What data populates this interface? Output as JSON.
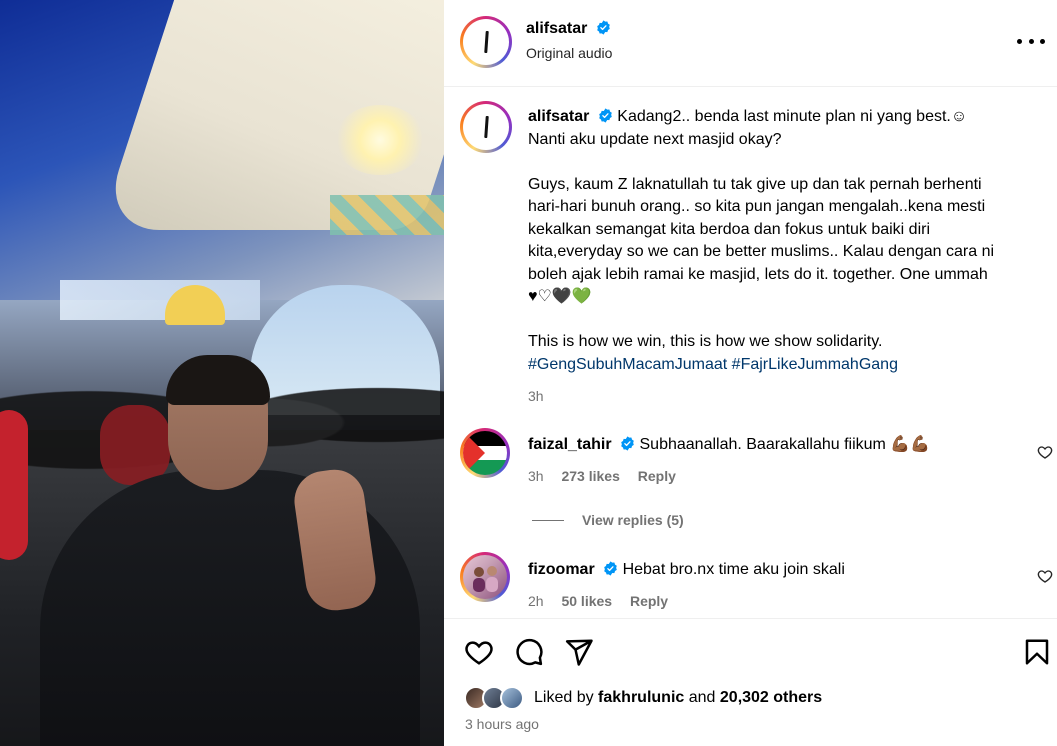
{
  "post": {
    "username": "alifsatar",
    "audio": "Original audio",
    "caption_lines": [
      "Kadang2.. benda last minute plan ni yang best.☺",
      "Nanti aku update next masjid okay?",
      "",
      "Guys, kaum Z laknatullah tu tak give up dan tak pernah berhenti",
      "hari-hari bunuh orang.. so kita pun jangan mengalah..kena mesti",
      "kekalkan semangat kita berdoa dan fokus untuk baiki diri",
      "kita,everyday so we can be better muslims.. Kalau dengan cara ni",
      "boleh ajak lebih ramai ke masjid, lets do it. together. One ummah",
      "♥♡🖤💚",
      "",
      "This is how we win, this is how we show solidarity."
    ],
    "hashtags": "#GengSubuhMacamJumaat #FajrLikeJummahGang",
    "caption_time": "3h"
  },
  "comments": [
    {
      "username": "faizal_tahir",
      "text": "Subhaanallah. Baarakallahu fiikum 💪🏾💪🏾",
      "time": "3h",
      "likes": "273 likes",
      "reply": "Reply",
      "view_replies": "View replies (5)"
    },
    {
      "username": "fizoomar",
      "text": "Hebat bro.nx time aku join skali",
      "time": "2h",
      "likes": "50 likes",
      "reply": "Reply"
    }
  ],
  "likes_summary": {
    "prefix": "Liked by",
    "user": "fakhrulunic",
    "connector": "and",
    "others": "20,302 others"
  },
  "timestamp": "3 hours ago",
  "colors": {
    "hashtag": "#00376b",
    "verified": "#0095f6",
    "muted": "#737373"
  },
  "icons": [
    "more-icon",
    "verified-icon",
    "heart-icon",
    "comment-icon",
    "share-icon",
    "save-icon"
  ]
}
